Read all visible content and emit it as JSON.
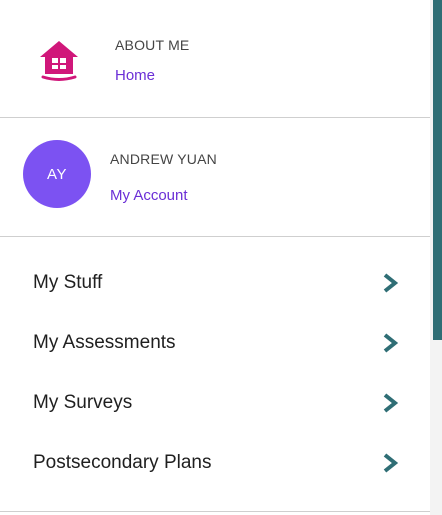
{
  "about": {
    "heading": "ABOUT ME",
    "link_label": "Home",
    "icon": "home-icon"
  },
  "account": {
    "name": "ANDREW YUAN",
    "initials": "AY",
    "link_label": "My Account"
  },
  "menu": {
    "items": [
      {
        "label": "My Stuff",
        "icon": "chevron-right-icon"
      },
      {
        "label": "My Assessments",
        "icon": "chevron-right-icon"
      },
      {
        "label": "My Surveys",
        "icon": "chevron-right-icon"
      },
      {
        "label": "Postsecondary Plans",
        "icon": "chevron-right-icon"
      }
    ]
  },
  "colors": {
    "accent": "#6b2fd6",
    "avatar": "#7c52f2",
    "home_icon": "#d0177a",
    "chevron": "#2f6e75",
    "scrollbar": "#2f6e75"
  }
}
